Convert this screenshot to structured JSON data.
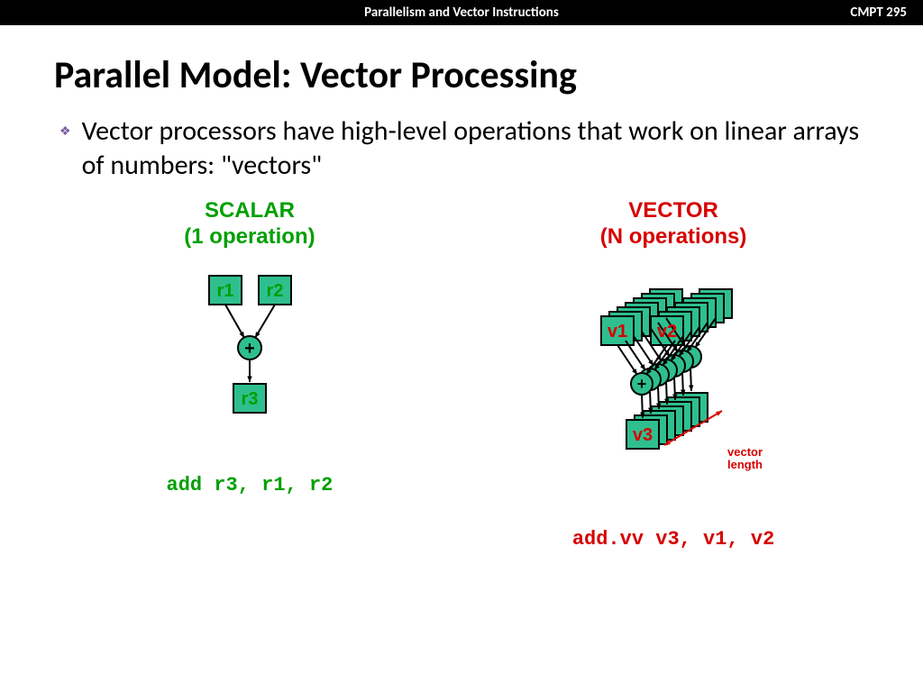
{
  "header": {
    "center": "Parallelism and Vector Instructions",
    "right": "CMPT 295"
  },
  "title": "Parallel Model: Vector Processing",
  "bullet": "Vector processors have high-level operations that work on linear arrays of numbers: \"vectors\"",
  "scalar": {
    "heading_line1": "SCALAR",
    "heading_line2": "(1 operation)",
    "r1": "r1",
    "r2": "r2",
    "r3": "r3",
    "plus": "+",
    "code": "add r3, r1, r2"
  },
  "vector": {
    "heading_line1": "VECTOR",
    "heading_line2": "(N operations)",
    "v1": "v1",
    "v2": "v2",
    "v3": "v3",
    "plus": "+",
    "label_line1": "vector",
    "label_line2": "length",
    "code": "add.vv v3, v1, v2"
  },
  "diagram": {
    "colors": {
      "box_fill": "#2fbf8f",
      "box_stroke": "#000",
      "arrow": "#000",
      "scalar_text": "#00a000",
      "vector_text": "#d60000",
      "vec_arrow": "#d60000"
    },
    "vector_depth": 7
  }
}
